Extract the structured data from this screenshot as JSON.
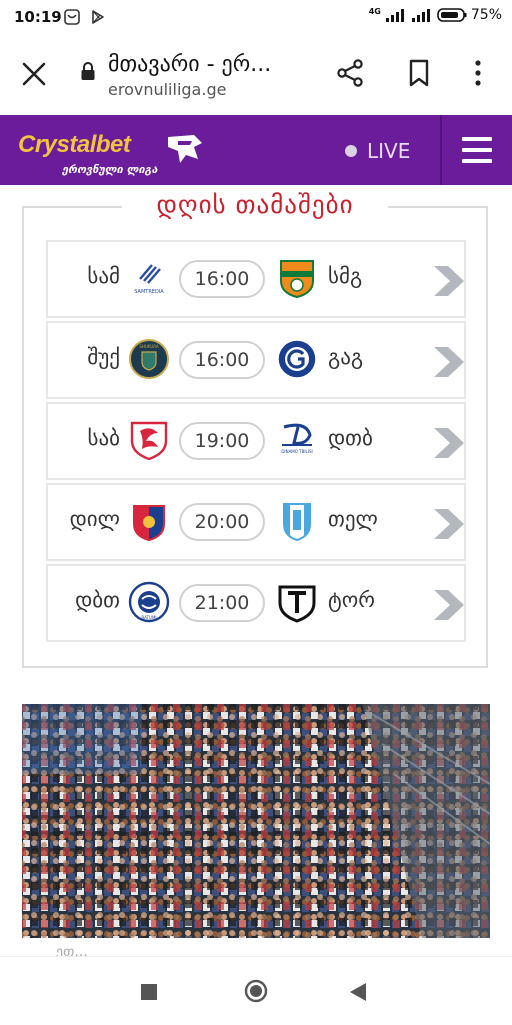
{
  "status_bar": {
    "time": "10:19",
    "network_label": "4G",
    "battery": "75%"
  },
  "browser": {
    "page_title": "მთავარი - ერ...",
    "url": "erovnuliliga.ge",
    "icons": [
      "close-icon",
      "lock-icon",
      "share-icon",
      "bookmark-icon",
      "more-vert-icon"
    ]
  },
  "header": {
    "brand_main": "Crystalbet",
    "brand_sub": "ეროვნული ლიგა",
    "live_label": "LIVE",
    "accent_color": "#6a1c9b",
    "brand_color": "#f2c33c"
  },
  "games": {
    "title": "დღის თამაშები",
    "title_color": "#c8202c",
    "matches": [
      {
        "home": "სამ",
        "home_crest_text": "SAMTREDIA",
        "time": "16:00",
        "away": "სმგ"
      },
      {
        "home": "შუქ",
        "home_crest_text": "SHUKURA",
        "time": "16:00",
        "away": "გაგ"
      },
      {
        "home": "საბ",
        "home_crest_text": "",
        "time": "19:00",
        "away": "დთბ",
        "away_crest_text": "DINAMO TBILISI"
      },
      {
        "home": "დილ",
        "home_crest_text": "",
        "time": "20:00",
        "away": "თელ"
      },
      {
        "home": "დბთ",
        "home_crest_text": "BATUMI",
        "time": "21:00",
        "away": "ტორ"
      }
    ]
  },
  "photo_caption": "ეთ..."
}
